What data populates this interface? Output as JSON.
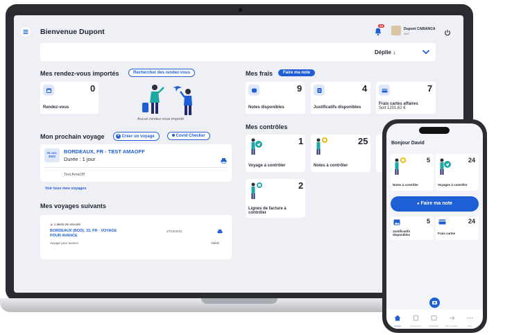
{
  "header": {
    "title": "Bienvenue Dupont",
    "notif_count": "12",
    "user_name": "Dupont CABIANCA",
    "user_sub": "AAC"
  },
  "filter": {
    "label": "Déplie ↓"
  },
  "rdv": {
    "title": "Mes rendez-vous importés",
    "search_button": "Rechercher des rendez-vous",
    "count": "0",
    "label": "Rendez-vous",
    "empty": "Aucun rendez-vous importé"
  },
  "next_trip": {
    "title": "Mon prochain voyage",
    "create_button": "Créer un voyage",
    "covid_button": "Covid Checker",
    "date_day": "21 oct.",
    "date_year": "2022",
    "name": "BORDEAUX, FR - TEST AMAOFF",
    "duration": "Durée : 1 jour",
    "traveler": "Test AmaOff",
    "see_all": "Voir tous mes voyages"
  },
  "following": {
    "title": "Mes voyages suivants",
    "alert": "1 alerte de sécurité",
    "trip": "BORDEAUX (BOD), 33, FR - VOYAGE POUR AVANCE",
    "date": "27/10/2022",
    "sub": "Voyage pour avance",
    "status": "Validé"
  },
  "frais": {
    "title": "Mes frais",
    "button": "Faire ma note",
    "cards": [
      {
        "count": "9",
        "label": "Notes disponibles",
        "sub": ""
      },
      {
        "count": "4",
        "label": "Justificatifs disponibles",
        "sub": ""
      },
      {
        "count": "7",
        "label": "Frais cartes affaires",
        "sub": "Soit 1201,62 €"
      }
    ]
  },
  "controles": {
    "title": "Mes contrôles",
    "cards": [
      {
        "count": "1",
        "label": "Voyage à contrôler"
      },
      {
        "count": "25",
        "label": "Notes à contrôler"
      },
      {
        "count": "2",
        "label": "Lignes de facture à contrôler"
      }
    ]
  },
  "phone": {
    "greeting": "Bonjour David",
    "cards": [
      {
        "count": "5",
        "label": "Notes à contrôler"
      },
      {
        "count": "24",
        "label": "Voyages à contrôler"
      },
      {
        "count": "5",
        "label": "Justificatifs disponibles"
      },
      {
        "count": "24",
        "label": "Frais cartes"
      }
    ],
    "button": "Faire ma note",
    "nav": [
      "Accueil",
      "Documents",
      "Justificatifs",
      "Mes voyages",
      "Plus"
    ]
  },
  "colors": {
    "accent": "#1f5fd6",
    "background": "#eef0f6"
  }
}
